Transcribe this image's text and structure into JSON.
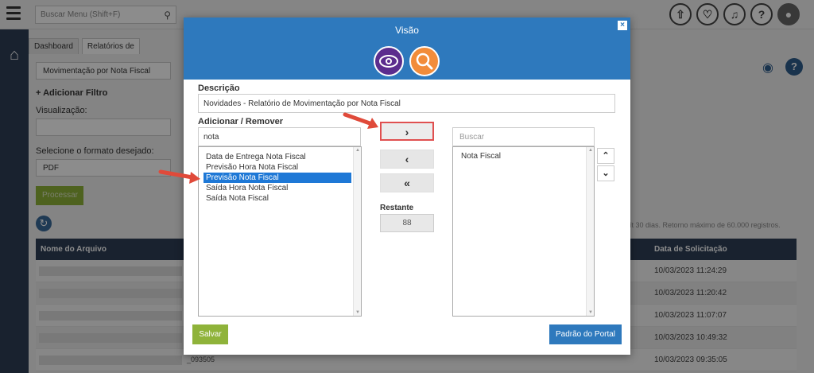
{
  "background": {
    "search_placeholder": "Buscar Menu  (Shift+F)",
    "tabs": [
      "Dashboard",
      "Relatórios de"
    ],
    "report_select": "Movimentação por Nota Fiscal",
    "add_filter": "+ Adicionar Filtro",
    "visualizacao_label": "Visualização:",
    "format_label": "Selecione o formato desejado:",
    "format_value": "PDF",
    "process_button": "Processar",
    "note": "ít 30 dias. Retorno máximo de 60.000 registros.",
    "table": {
      "col_file": "Nome do Arquivo",
      "col_date": "Data de Solicitação",
      "rows": [
        {
          "date": "10/03/2023 11:24:29",
          "file": ""
        },
        {
          "date": "10/03/2023 11:20:42",
          "file": ""
        },
        {
          "date": "10/03/2023 11:07:07",
          "file": ""
        },
        {
          "date": "10/03/2023 10:49:32",
          "file": ""
        },
        {
          "date": "10/03/2023 09:35:05",
          "file": "_093505"
        }
      ]
    }
  },
  "modal": {
    "title": "Visão",
    "descricao_label": "Descrição",
    "descricao_value": "Novidades - Relatório de Movimentação por Nota Fiscal",
    "add_remove_label": "Adicionar / Remover",
    "filter_value": "nota",
    "available_items": [
      "Data de Entrega Nota Fiscal",
      "Previsão Hora Nota Fiscal",
      "Previsão Nota Fiscal",
      "Saída Hora Nota Fiscal",
      "Saída Nota Fiscal"
    ],
    "selected_available_index": 2,
    "buttons": {
      "add": "›",
      "remove": "‹",
      "remove_all": "«"
    },
    "restante_label": "Restante",
    "restante_value": "88",
    "search_placeholder": "Buscar",
    "selected_items": [
      "Nota Fiscal"
    ],
    "save_label": "Salvar",
    "default_label": "Padrão do Portal"
  },
  "colors": {
    "header_blue": "#2e79bd",
    "nav_dark": "#2e3f57",
    "green": "#8fb33a",
    "selection": "#1e78d6",
    "annotation_red": "#e05050"
  }
}
